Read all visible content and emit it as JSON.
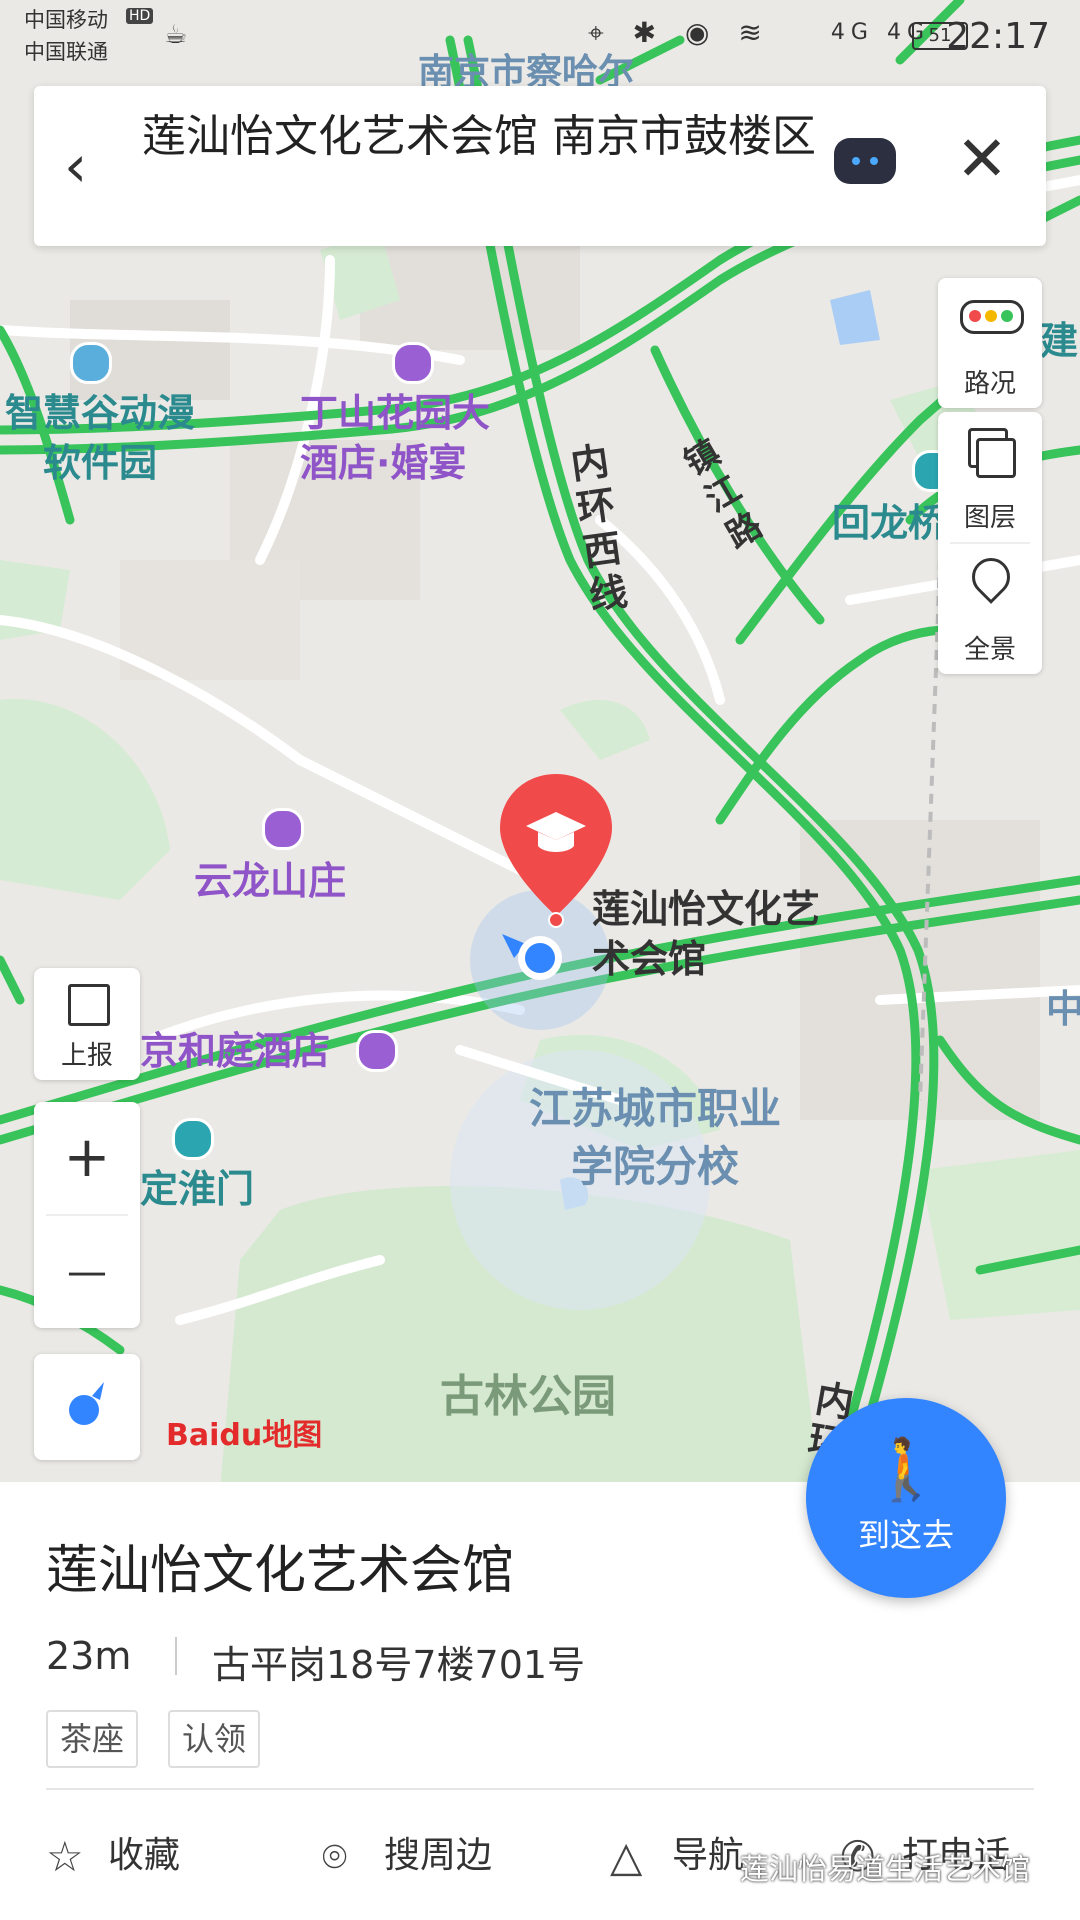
{
  "status_bar": {
    "carrier1": "中国移动",
    "carrier1_badge": "HD",
    "carrier2": "中国联通",
    "signal_text": "4G 4G",
    "battery": "51",
    "time": "22:17"
  },
  "search": {
    "query": "莲汕怡文化艺术会馆 南京市鼓楼区"
  },
  "map": {
    "top_label": "南京市察哈尔",
    "controls_right": [
      "路况",
      "图层",
      "全景"
    ],
    "control_report": "上报",
    "zoom_in": "+",
    "zoom_out": "—",
    "pois": {
      "zhihuigu": "智慧谷动漫\n软件园",
      "dingshan": "丁山花园大\n酒店·婚宴",
      "huilong": "回龙桥小学",
      "yunlong": "云龙山庄",
      "jinghe": "京和庭酒店",
      "dinghuai": "定淮门",
      "jiangsu": "江苏城市职业\n学院分校",
      "gulin": "古林公园",
      "right_edge": "中",
      "right_edge2": "建"
    },
    "roads": {
      "neihuan": "内环西线",
      "zhenjiang": "镇江路",
      "neihuan_bottom": "内环"
    },
    "target_label": "莲汕怡文化艺\n术会馆",
    "logo": "Baidu地图",
    "colors": {
      "road": "#38c45a",
      "pin": "#f04a4a",
      "poi_purple": "#9a5fd2",
      "teal": "#2ba6b0",
      "locate": "#3385ff"
    }
  },
  "place": {
    "name": "莲汕怡文化艺术会馆",
    "distance": "23m",
    "address": "古平岗18号7楼701号",
    "tags": [
      "茶座",
      "认领"
    ],
    "actions": [
      "收藏",
      "搜周边",
      "导航",
      "打电话"
    ]
  },
  "goto_button": "到这去",
  "watermark": "莲汕怡易道生活艺术馆"
}
